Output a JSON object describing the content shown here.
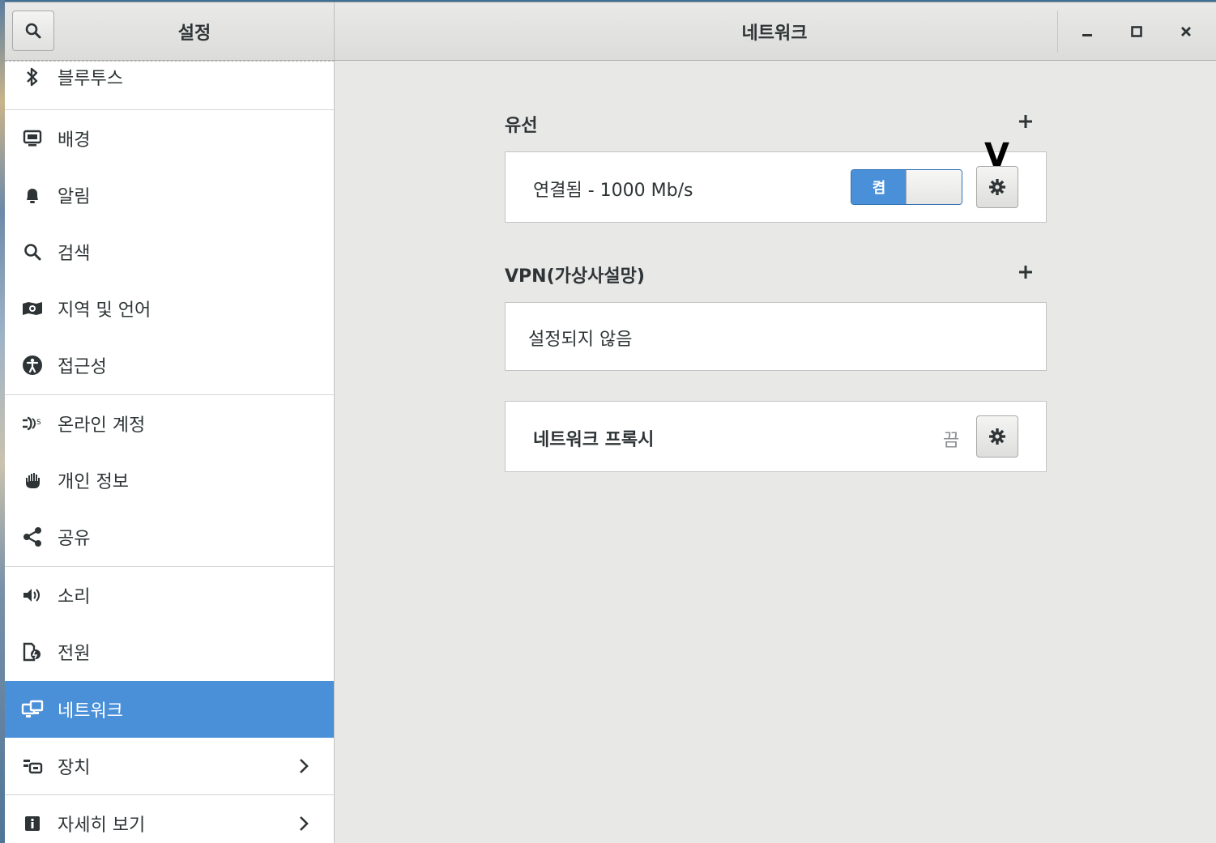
{
  "header": {
    "sidebar_title": "설정",
    "page_title": "네트워크"
  },
  "sidebar": {
    "items": [
      {
        "label": "블루투스",
        "icon": "bluetooth-icon"
      },
      {
        "label": "배경",
        "icon": "background-icon"
      },
      {
        "label": "알림",
        "icon": "bell-icon"
      },
      {
        "label": "검색",
        "icon": "search-icon"
      },
      {
        "label": "지역 및 언어",
        "icon": "region-icon"
      },
      {
        "label": "접근성",
        "icon": "accessibility-icon"
      },
      {
        "label": "온라인 계정",
        "icon": "online-accounts-icon"
      },
      {
        "label": "개인 정보",
        "icon": "privacy-hand-icon"
      },
      {
        "label": "공유",
        "icon": "share-icon"
      },
      {
        "label": "소리",
        "icon": "speaker-icon"
      },
      {
        "label": "전원",
        "icon": "power-icon"
      },
      {
        "label": "네트워크",
        "icon": "network-icon",
        "selected": true
      },
      {
        "label": "장치",
        "icon": "devices-icon",
        "has_submenu": true
      },
      {
        "label": "자세히 보기",
        "icon": "info-icon",
        "has_submenu": true
      }
    ]
  },
  "main": {
    "wired": {
      "title": "유선",
      "status": "연결됨 - 1000 Mb/s",
      "switch_label": "켬",
      "switch_on": true
    },
    "vpn": {
      "title": "VPN(가상사설망)",
      "status": "설정되지 않음"
    },
    "proxy": {
      "title": "네트워크 프록시",
      "status": "끔"
    },
    "cursor_label": "V"
  },
  "colors": {
    "accent": "#4a90d9",
    "window_bg": "#e8e8e7",
    "text": "#2e3436"
  }
}
